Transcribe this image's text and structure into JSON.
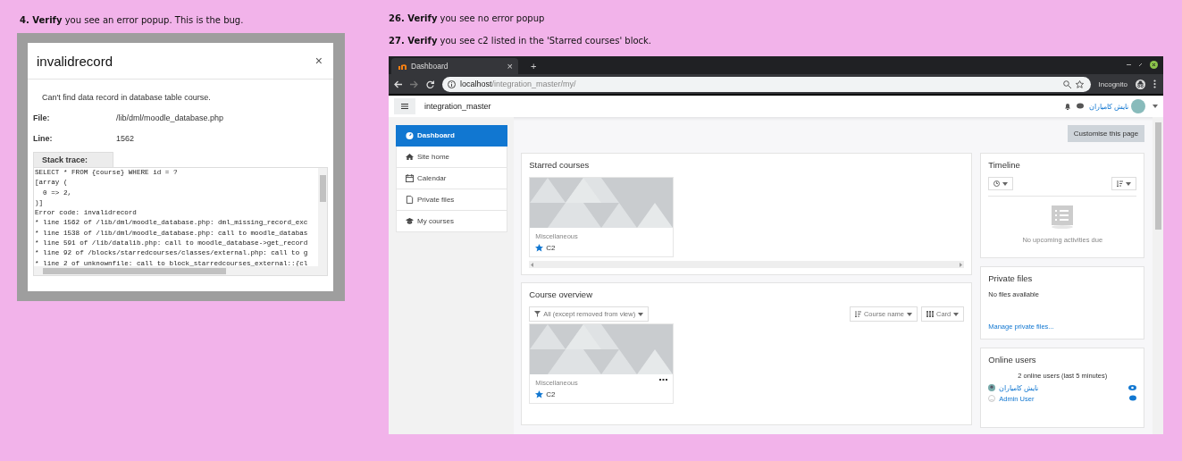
{
  "left": {
    "instruction": "**4. Verify** you see an error popup. This is the bug.",
    "modal": {
      "title": "invalidrecord",
      "close": "×",
      "message": "Can't find data record in database table course.",
      "fields": [
        {
          "label": "File:",
          "value": "/lib/dml/moodle_database.php"
        },
        {
          "label": "Line:",
          "value": "1562"
        }
      ],
      "stack_tab": "Stack trace:",
      "stack_lines": [
        "SELECT * FROM {course} WHERE id = ?",
        "[array (",
        "  0 => 2,",
        ")]",
        "Error code: invalidrecord",
        "* line 1562 of /lib/dml/moodle_database.php: dml_missing_record_exc",
        "* line 1538 of /lib/dml/moodle_database.php: call to moodle_databas",
        "* line 591 of /lib/datalib.php: call to moodle_database->get_record",
        "* line 92 of /blocks/starredcourses/classes/external.php: call to g",
        "* line 2 of unknownfile: call to block_starredcourses_external::{cl"
      ]
    }
  },
  "right": {
    "instructions": [
      "**26. Verify** you see no error popup",
      "**27. Verify** you see c2 listed in the 'Starred courses' block."
    ],
    "browser": {
      "tab": {
        "title": "Dashboard",
        "close": "×"
      },
      "new_tab": "+",
      "url_host": "localhost",
      "url_path": "/integration_master/my/",
      "incognito": "Incognito",
      "page": {
        "site_name": "integration_master",
        "user_name": "نایش کامیاران",
        "nav": [
          {
            "label": "Dashboard",
            "kind": "dashboard",
            "selected": true
          },
          {
            "label": "Site home",
            "kind": "home",
            "selected": false
          },
          {
            "label": "Calendar",
            "kind": "calendar",
            "selected": false
          },
          {
            "label": "Private files",
            "kind": "file",
            "selected": false
          },
          {
            "label": "My courses",
            "kind": "cap",
            "selected": false
          }
        ],
        "customise_button": "Customise this page",
        "starred": {
          "title": "Starred courses",
          "course": {
            "category": "Miscellaneous",
            "name": "C2"
          }
        },
        "overview": {
          "title": "Course overview",
          "filter": "All (except removed from view)",
          "sort": "Course name",
          "view": "Card",
          "course": {
            "category": "Miscellaneous",
            "name": "C2"
          }
        },
        "timeline": {
          "title": "Timeline",
          "empty": "No upcoming activities due"
        },
        "private_files": {
          "title": "Private files",
          "empty": "No files available",
          "link": "Manage private files..."
        },
        "online_users": {
          "title": "Online users",
          "summary": "2 online users (last 5 minutes)",
          "users": [
            {
              "name": "نایش کامیاران",
              "kind": "photo"
            },
            {
              "name": "Admin User",
              "kind": "default"
            }
          ]
        }
      }
    }
  }
}
